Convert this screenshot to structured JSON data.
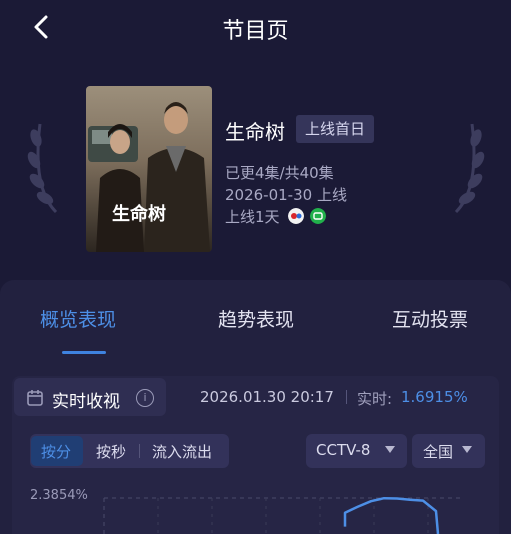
{
  "header": {
    "title": "节目页"
  },
  "show": {
    "name": "生命树",
    "badge": "上线首日",
    "episodes": "已更4集/共40集",
    "launch_date": "2026-01-30 上线",
    "days_online": "上线1天",
    "poster_title": "生命树"
  },
  "tabs": [
    {
      "label": "概览表现",
      "active": true
    },
    {
      "label": "趋势表现",
      "active": false
    },
    {
      "label": "互动投票",
      "active": false
    }
  ],
  "realtime": {
    "label": "实时收视",
    "timestamp": "2026.01.30 20:17",
    "rate_label": "实时:",
    "rate_value": "1.6915%"
  },
  "granularity": {
    "options": [
      "按分",
      "按秒",
      "流入流出"
    ],
    "selected": "按分"
  },
  "filters": {
    "channel": "CCTV-8",
    "region": "全国"
  },
  "chart_data": {
    "type": "line",
    "ylabel_max_tick": "2.3854%",
    "series": [
      {
        "values": [
          1.9,
          2.1,
          2.28,
          2.38,
          2.37,
          2.33,
          2.3,
          1.95
        ]
      }
    ],
    "ylim": [
      0,
      2.3854
    ],
    "grid": true
  },
  "colors": {
    "accent": "#4d8fe6",
    "background": "#1b1a36",
    "panel": "#22213f"
  }
}
